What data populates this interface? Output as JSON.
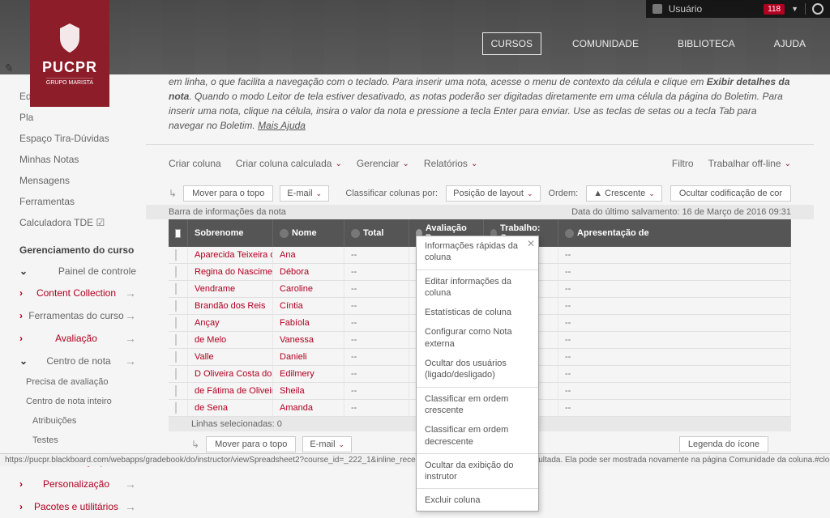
{
  "topbar": {
    "user_label": "Usuário",
    "badge": "118"
  },
  "brand": {
    "name": "PUCPR",
    "sub": "GRUPO MARISTA"
  },
  "nav": {
    "cursos": "CURSOS",
    "comunidade": "COMUNIDADE",
    "biblioteca": "BIBLIOTECA",
    "ajuda": "AJUDA"
  },
  "sidebar": {
    "edi": "Edi",
    "pla": "Pla",
    "espaco": "Espaço Tira-Dúvidas",
    "minhas_notas": "Minhas Notas",
    "mensagens": "Mensagens",
    "ferramentas": "Ferramentas",
    "calculadora": "Calculadora TDE ☑",
    "gerenciamento": "Gerenciamento do curso",
    "painel": "Painel de controle",
    "content": "Content Collection",
    "ferr_curso": "Ferramentas do curso",
    "avaliacao": "Avaliação",
    "centro": "Centro de nota",
    "precisa": "Precisa de avaliação",
    "centro_int": "Centro de nota inteiro",
    "atrib": "Atribuições",
    "testes": "Testes",
    "usuarios": "Usuários e grupos",
    "personal": "Personalização",
    "pacotes": "Pacotes e utilitários"
  },
  "help": {
    "line1_a": "em linha, o que facilita a navegação com o teclado. Para inserir uma nota, acesse o menu de contexto da célula e clique em ",
    "line1_b": "Exibir detalhes da nota",
    "line1_c": ". Quando o modo Leitor de tela estiver desativado, as notas poderão ser digitadas diretamente em uma célula da página do Boletim. Para inserir uma nota, clique na célula, insira o valor da nota e pressione a tecla Enter para enviar. Use as teclas de setas ou a tecla Tab para navegar no Boletim. ",
    "link": "Mais Ajuda"
  },
  "toolbar": {
    "criar_coluna": "Criar coluna",
    "criar_calculada": "Criar coluna calculada",
    "gerenciar": "Gerenciar",
    "relatorios": "Relatórios",
    "filtro": "Filtro",
    "offline": "Trabalhar off-line"
  },
  "actions": {
    "mover_topo": "Mover para o topo",
    "email": "E-mail",
    "classificar": "Classificar colunas por:",
    "posicao": "Posição de layout",
    "ordem": "Ordem:",
    "crescente": "▲ Crescente",
    "ocultar_cod": "Ocultar codificação de cor"
  },
  "info": {
    "barra": "Barra de informações da nota",
    "data": "Data do último salvamento: 16 de Março de 2016 09:31"
  },
  "columns": {
    "sobrenome": "Sobrenome",
    "nome": "Nome",
    "total": "Total",
    "avaliacao": "Avaliação Preser",
    "trabalho": "Trabalho: Conce",
    "apresentacao": "Apresentação de"
  },
  "rows": [
    {
      "s": "Aparecida Teixeira da",
      "n": "Ana",
      "t": "--",
      "ap": "--"
    },
    {
      "s": "Regina do Nascimen",
      "n": "Débora",
      "t": "--",
      "ap": "--"
    },
    {
      "s": "Vendrame",
      "n": "Caroline",
      "t": "--",
      "ap": "--"
    },
    {
      "s": "Brandão dos Reis",
      "n": "Cíntia",
      "t": "--",
      "ap": "--"
    },
    {
      "s": "Ançay",
      "n": "Fabíola",
      "t": "--",
      "ap": "--"
    },
    {
      "s": "de Melo",
      "n": "Vanessa",
      "t": "--",
      "ap": "--"
    },
    {
      "s": "Valle",
      "n": "Danieli",
      "t": "--",
      "ap": "--"
    },
    {
      "s": "D Oliveira Costa dos",
      "n": "Edilmery",
      "t": "--",
      "ap": "--"
    },
    {
      "s": "de Fátima de Oliveira",
      "n": "Sheila",
      "t": "--",
      "ap": "--"
    },
    {
      "s": "de Sena",
      "n": "Amanda",
      "t": "--",
      "ap": "--"
    }
  ],
  "context": {
    "info_rapida": "Informações rápidas da coluna",
    "editar": "Editar informações da coluna",
    "estatisticas": "Estatísticas de coluna",
    "configurar": "Configurar como Nota externa",
    "ocultar_usuarios": "Ocultar dos usuários (ligado/desligado)",
    "classificar_cresc": "Classificar em ordem crescente",
    "classificar_decresc": "Classificar em ordem decrescente",
    "ocultar_exib": "Ocultar da exibição do instrutor",
    "excluir": "Excluir coluna"
  },
  "footer": {
    "linhas": "Linhas selecionadas: 0",
    "legenda": "Legenda do ícone"
  },
  "status": "https://pucpr.blackboard.com/webapps/gradebook/do/instructor/viewSpreadsheet2?course_id=_222_1&inline_receipt_message=Sucesso: Coluna ocultada. Ela pode ser mostrada novamente na página Comunidade da coluna.#close"
}
